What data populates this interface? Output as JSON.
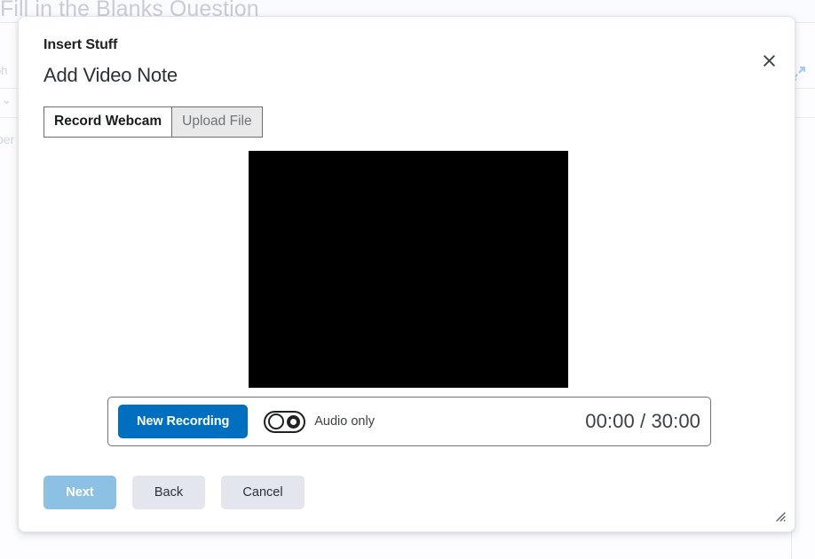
{
  "background": {
    "heading": "Fill in the Blanks Question",
    "toolbar_label": "ph",
    "chevron_icon": "chevron-down-icon",
    "body_text": "per",
    "expand_icon": "expand-fullscreen-icon"
  },
  "modal": {
    "eyebrow": "Insert Stuff",
    "title": "Add Video Note",
    "close_icon": "close-icon",
    "resize_icon": "resize-grip-icon",
    "tabs": [
      {
        "label": "Record Webcam",
        "active": true
      },
      {
        "label": "Upload File",
        "active": false
      }
    ],
    "video": {
      "state": "black-preview"
    },
    "controls": {
      "record_button_label": "New Recording",
      "record_button_color": "#006fbf",
      "audio_toggle": {
        "label": "Audio only",
        "checked": false
      },
      "timer": "00:00 / 30:00",
      "elapsed": "00:00",
      "duration": "30:00"
    },
    "footer": {
      "next_label": "Next",
      "next_disabled": true,
      "next_color": "#8cc1e3",
      "back_label": "Back",
      "cancel_label": "Cancel"
    }
  }
}
